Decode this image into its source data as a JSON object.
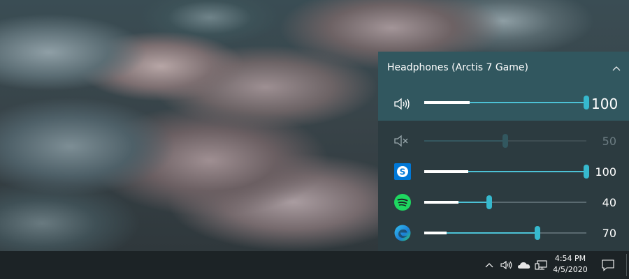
{
  "volume_flyout": {
    "device_name": "Headphones (Arctis 7 Game)",
    "master": {
      "icon": "speaker-icon",
      "value": "100",
      "level": 1.0,
      "peak": 0.28
    },
    "apps": [
      {
        "name": "system-sounds",
        "icon": "speaker-muted-icon",
        "value": "50",
        "level": 0.5,
        "peak": 0.0,
        "muted": true
      },
      {
        "name": "skype",
        "icon": "skype-icon",
        "value": "100",
        "level": 1.0,
        "peak": 0.27
      },
      {
        "name": "spotify",
        "icon": "spotify-icon",
        "value": "40",
        "level": 0.4,
        "peak": 0.21
      },
      {
        "name": "edge",
        "icon": "edge-icon",
        "value": "70",
        "level": 0.7,
        "peak": 0.14
      }
    ]
  },
  "taskbar": {
    "tray_icons": [
      "chevron-up-icon",
      "speaker-icon",
      "onedrive-cloud-icon",
      "network-icon"
    ],
    "time": "4:54 PM",
    "date": "4/5/2020",
    "notification_icon": "action-center-icon"
  },
  "colors": {
    "accent": "#4cc2d6",
    "thumb": "#36b9ce",
    "header": "#31575f",
    "flyout_bg": "#2c3b40",
    "taskbar_bg": "#1c2326"
  }
}
